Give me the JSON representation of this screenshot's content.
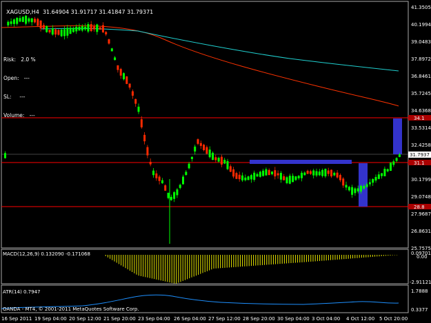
{
  "header": {
    "symbol_tf": "XAGUSD,H4",
    "ohlc": "31.64904 31.91717 31.41847 31.79371"
  },
  "info_panel": {
    "risk": "Risk:   2.0 %",
    "open": "Open:   ---",
    "sl": "SL:     ---",
    "volume": "Volume:   ---"
  },
  "price_axis": {
    "labels": [
      "41.3505",
      "40.1994",
      "39.0483",
      "37.8972",
      "36.8461",
      "35.7245",
      "34.6368",
      "33.5314",
      "32.4258",
      "31.7937",
      "30.1799",
      "29.0748",
      "27.9687",
      "26.8631",
      "25.7575"
    ],
    "current_price": "31.7937"
  },
  "level_tags": {
    "top": "34.1",
    "mid": "31.1",
    "bottom": "28.8"
  },
  "macd": {
    "label": "MACD(12,26,9) 0.132090 -0.171068",
    "axis_top": "0.09701",
    "axis_top2": "0.00",
    "axis_bottom": "-2.91121"
  },
  "atr": {
    "label": "ATR(14) 0.7947",
    "axis_top": "1.7888",
    "axis_bottom": "0.3377"
  },
  "footer": {
    "copyright": "OANDA - MT4, © 2001-2011 MetaQuotes Software Corp."
  },
  "time_axis": [
    "16 Sep 2011",
    "19 Sep 04:00",
    "20 Sep 12:00",
    "21 Sep 20:00",
    "23 Sep 04:00",
    "26 Sep 04:00",
    "27 Sep 12:00",
    "28 Sep 20:00",
    "30 Sep 04:00",
    "3 Oct 04:00",
    "4 Oct 12:00",
    "5 Oct 20:00"
  ],
  "colors": {
    "background": "#000000",
    "bull": "#00ff00",
    "bear": "#ff2a00",
    "ma_slow": "#ff3300",
    "ma_fast": "#00ffff",
    "level_line": "#ff0000",
    "box": "#3333cc",
    "macd_hist": "#ffff00",
    "atr_line": "#1e90ff",
    "price_tag_bg": "#ffffff"
  }
}
